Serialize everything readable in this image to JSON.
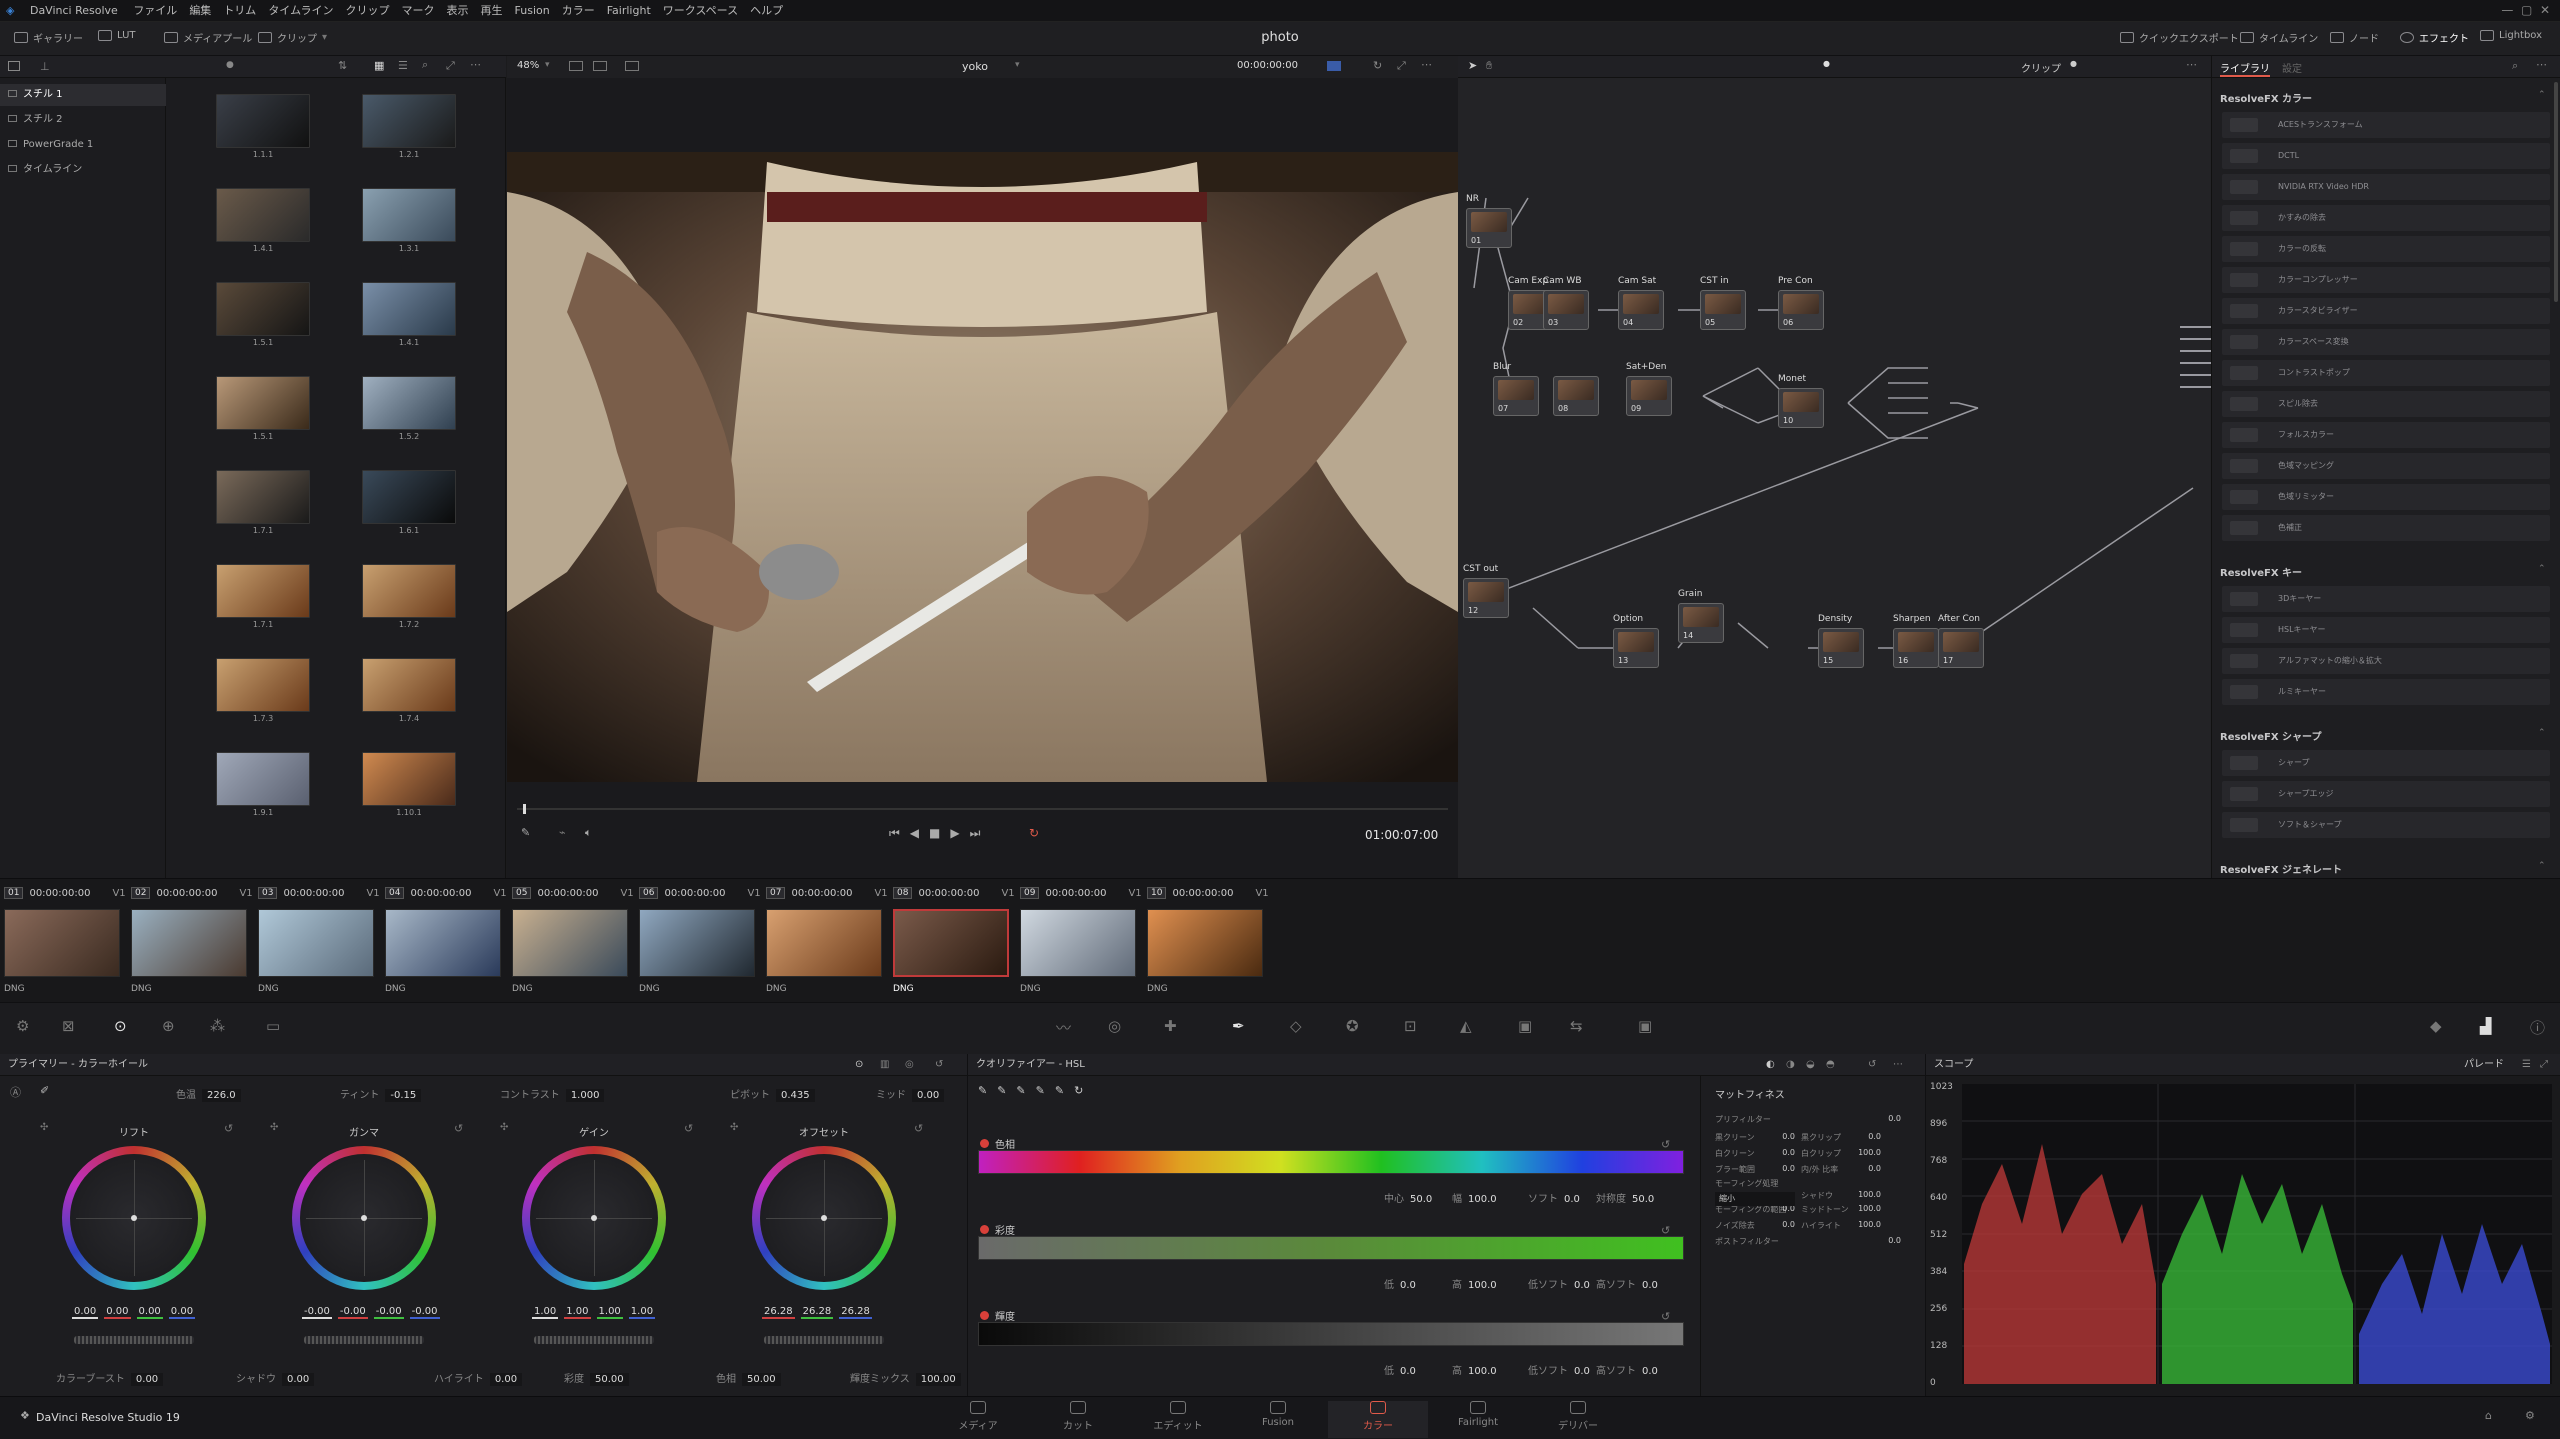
{
  "app": {
    "name": "DaVinci Resolve",
    "menus": [
      "ファイル",
      "編集",
      "トリム",
      "タイムライン",
      "クリップ",
      "マーク",
      "表示",
      "再生",
      "Fusion",
      "カラー",
      "Fairlight",
      "ワークスペース",
      "ヘルプ"
    ],
    "project_title": "photo",
    "footer_brand": "DaVinci Resolve Studio 19"
  },
  "toolbar": {
    "left": [
      "ギャラリー",
      "LUT",
      "メディアプール",
      "クリップ"
    ],
    "right": [
      "クイックエクスポート",
      "タイムライン",
      "ノード",
      "エフェクト",
      "Lightbox"
    ]
  },
  "gallery": {
    "albums": [
      "スチル 1",
      "スチル 2",
      "PowerGrade 1",
      "タイムライン"
    ],
    "stills": [
      "1.1.1",
      "1.2.1",
      "1.4.1",
      "1.3.1",
      "1.5.1",
      "1.4.1",
      "1.5.1",
      "1.5.2",
      "1.7.1",
      "1.6.1",
      "1.7.1",
      "1.7.2",
      "1.7.3",
      "1.7.4",
      "1.9.1",
      "1.10.1"
    ]
  },
  "viewer": {
    "zoom": "48%",
    "clip_name": "yoko",
    "timecode_top": "00:00:00:00",
    "timecode": "01:00:07:00",
    "mode": "クリップ"
  },
  "nodes": {
    "labels": [
      "NR",
      "Cam Exp",
      "Cam WB",
      "Cam Sat",
      "CST in",
      "Pre Con",
      "Blur",
      "Sat+Den",
      "Monet",
      "CST out",
      "Option",
      "Grain",
      "Density",
      "Sharpen",
      "After Con"
    ],
    "numbers": [
      "01",
      "02",
      "03",
      "04",
      "05",
      "06",
      "07",
      "08",
      "09",
      "10",
      "12",
      "13",
      "14",
      "15",
      "16",
      "17"
    ]
  },
  "fx": {
    "tabs": [
      "ライブラリ",
      "設定"
    ],
    "sections": [
      {
        "title": "ResolveFX カラー",
        "items": [
          "ACESトランスフォーム",
          "DCTL",
          "NVIDIA RTX Video HDR",
          "かすみの除去",
          "カラーの反転",
          "カラーコンプレッサー",
          "カラースタビライザー",
          "カラースペース変換",
          "コントラストポップ",
          "スピル除去",
          "フォルスカラー",
          "色域マッピング",
          "色域リミッター",
          "色補正"
        ]
      },
      {
        "title": "ResolveFX キー",
        "items": [
          "3Dキーヤー",
          "HSLキーヤー",
          "アルファマットの縮小＆拡大",
          "ルミキーヤー"
        ]
      },
      {
        "title": "ResolveFX シャープ",
        "items": [
          "シャープ",
          "シャープエッジ",
          "ソフト＆シャープ"
        ]
      },
      {
        "title": "ResolveFX ジェネレート",
        "items": []
      }
    ]
  },
  "clips": [
    {
      "num": "01",
      "tc": "00:00:00:00",
      "track": "V1",
      "fmt": "DNG"
    },
    {
      "num": "02",
      "tc": "00:00:00:00",
      "track": "V1",
      "fmt": "DNG"
    },
    {
      "num": "03",
      "tc": "00:00:00:00",
      "track": "V1",
      "fmt": "DNG"
    },
    {
      "num": "04",
      "tc": "00:00:00:00",
      "track": "V1",
      "fmt": "DNG"
    },
    {
      "num": "05",
      "tc": "00:00:00:00",
      "track": "V1",
      "fmt": "DNG"
    },
    {
      "num": "06",
      "tc": "00:00:00:00",
      "track": "V1",
      "fmt": "DNG"
    },
    {
      "num": "07",
      "tc": "00:00:00:00",
      "track": "V1",
      "fmt": "DNG"
    },
    {
      "num": "08",
      "tc": "00:00:00:00",
      "track": "V1",
      "fmt": "DNG"
    },
    {
      "num": "09",
      "tc": "00:00:00:00",
      "track": "V1",
      "fmt": "DNG"
    },
    {
      "num": "10",
      "tc": "00:00:00:00",
      "track": "V1",
      "fmt": "DNG"
    }
  ],
  "primary": {
    "title": "プライマリー - カラーホイール",
    "top_params": [
      {
        "label": "色温",
        "value": "226.0"
      },
      {
        "label": "ティント",
        "value": "-0.15"
      },
      {
        "label": "コントラスト",
        "value": "1.000"
      },
      {
        "label": "ピボット",
        "value": "0.435"
      },
      {
        "label": "ミッド",
        "value": "0.00"
      }
    ],
    "wheels": [
      {
        "name": "リフト",
        "values": [
          "0.00",
          "0.00",
          "0.00",
          "0.00"
        ]
      },
      {
        "name": "ガンマ",
        "values": [
          "-0.00",
          "-0.00",
          "-0.00",
          "-0.00"
        ]
      },
      {
        "name": "ゲイン",
        "values": [
          "1.00",
          "1.00",
          "1.00",
          "1.00"
        ]
      },
      {
        "name": "オフセット",
        "values": [
          "26.28",
          "26.28",
          "26.28"
        ]
      }
    ],
    "bottom_params": [
      {
        "label": "カラーブースト",
        "value": "0.00"
      },
      {
        "label": "シャドウ",
        "value": "0.00"
      },
      {
        "label": "ハイライト",
        "value": "0.00"
      },
      {
        "label": "彩度",
        "value": "50.00"
      },
      {
        "label": "色相",
        "value": "50.00"
      },
      {
        "label": "輝度ミックス",
        "value": "100.00"
      }
    ]
  },
  "hsl": {
    "title": "クオリファイアー - HSL",
    "hue": {
      "label": "色相",
      "params": [
        {
          "l": "中心",
          "v": "50.0"
        },
        {
          "l": "幅",
          "v": "100.0"
        },
        {
          "l": "ソフト",
          "v": "0.0"
        },
        {
          "l": "対称度",
          "v": "50.0"
        }
      ]
    },
    "sat": {
      "label": "彩度",
      "params": [
        {
          "l": "低",
          "v": "0.0"
        },
        {
          "l": "高",
          "v": "100.0"
        },
        {
          "l": "低ソフト",
          "v": "0.0"
        },
        {
          "l": "高ソフト",
          "v": "0.0"
        }
      ]
    },
    "lum": {
      "label": "輝度",
      "params": [
        {
          "l": "低",
          "v": "0.0"
        },
        {
          "l": "高",
          "v": "100.0"
        },
        {
          "l": "低ソフト",
          "v": "0.0"
        },
        {
          "l": "高ソフト",
          "v": "0.0"
        }
      ]
    },
    "matte_title": "マットフィネス",
    "matte": [
      {
        "l": "プリフィルター",
        "v": "0.0"
      },
      {
        "l": "黒クリーン",
        "v": "0.0"
      },
      {
        "l": "黒クリップ",
        "v": "0.0"
      },
      {
        "l": "白クリーン",
        "v": "0.0"
      },
      {
        "l": "白クリップ",
        "v": "100.0"
      },
      {
        "l": "ブラー範囲",
        "v": "0.0"
      },
      {
        "l": "内/外 比率",
        "v": "0.0"
      },
      {
        "l": "シャドウ",
        "v": "100.0"
      },
      {
        "l": "モーフィングの範囲",
        "v": "0.0"
      },
      {
        "l": "ミッドトーン",
        "v": "100.0"
      },
      {
        "l": "ノイズ除去",
        "v": "0.0"
      },
      {
        "l": "ハイライト",
        "v": "100.0"
      },
      {
        "l": "ポストフィルター",
        "v": "0.0"
      }
    ],
    "morph_label": "モーフィング処理",
    "morph_value": "縮小"
  },
  "scope": {
    "title": "スコープ",
    "mode": "パレード",
    "ticks": [
      "1023",
      "896",
      "768",
      "640",
      "512",
      "384",
      "256",
      "128",
      "0"
    ]
  },
  "pages": [
    "メディア",
    "カット",
    "エディット",
    "Fusion",
    "カラー",
    "Fairlight",
    "デリバー"
  ],
  "active_page": "カラー"
}
